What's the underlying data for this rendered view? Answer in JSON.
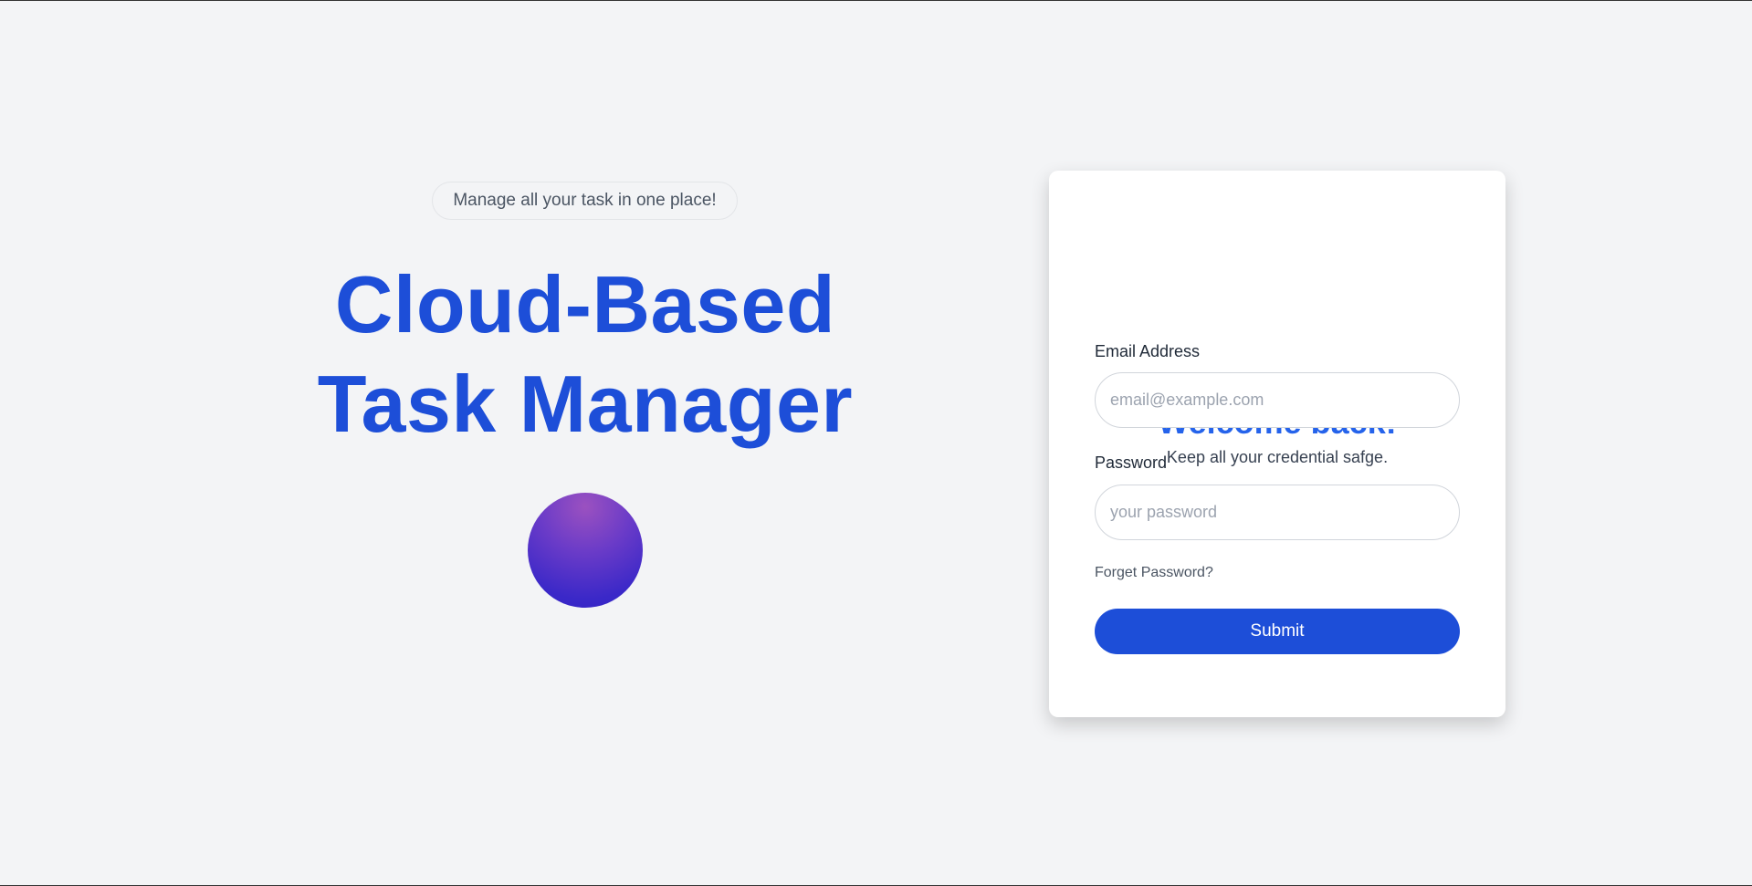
{
  "hero": {
    "tagline": "Manage all your task in one place!",
    "title_line1": "Cloud-Based",
    "title_line2": "Task Manager"
  },
  "login": {
    "title": "Welcome back!",
    "subtitle": "Keep all your credential safge.",
    "email_label": "Email Address",
    "email_placeholder": "email@example.com",
    "email_value": "",
    "password_label": "Password",
    "password_placeholder": "your password",
    "password_value": "",
    "forgot_label": "Forget Password?",
    "submit_label": "Submit"
  },
  "colors": {
    "accent": "#1d4ed8",
    "background": "#f3f4f6",
    "title": "#2563eb"
  }
}
